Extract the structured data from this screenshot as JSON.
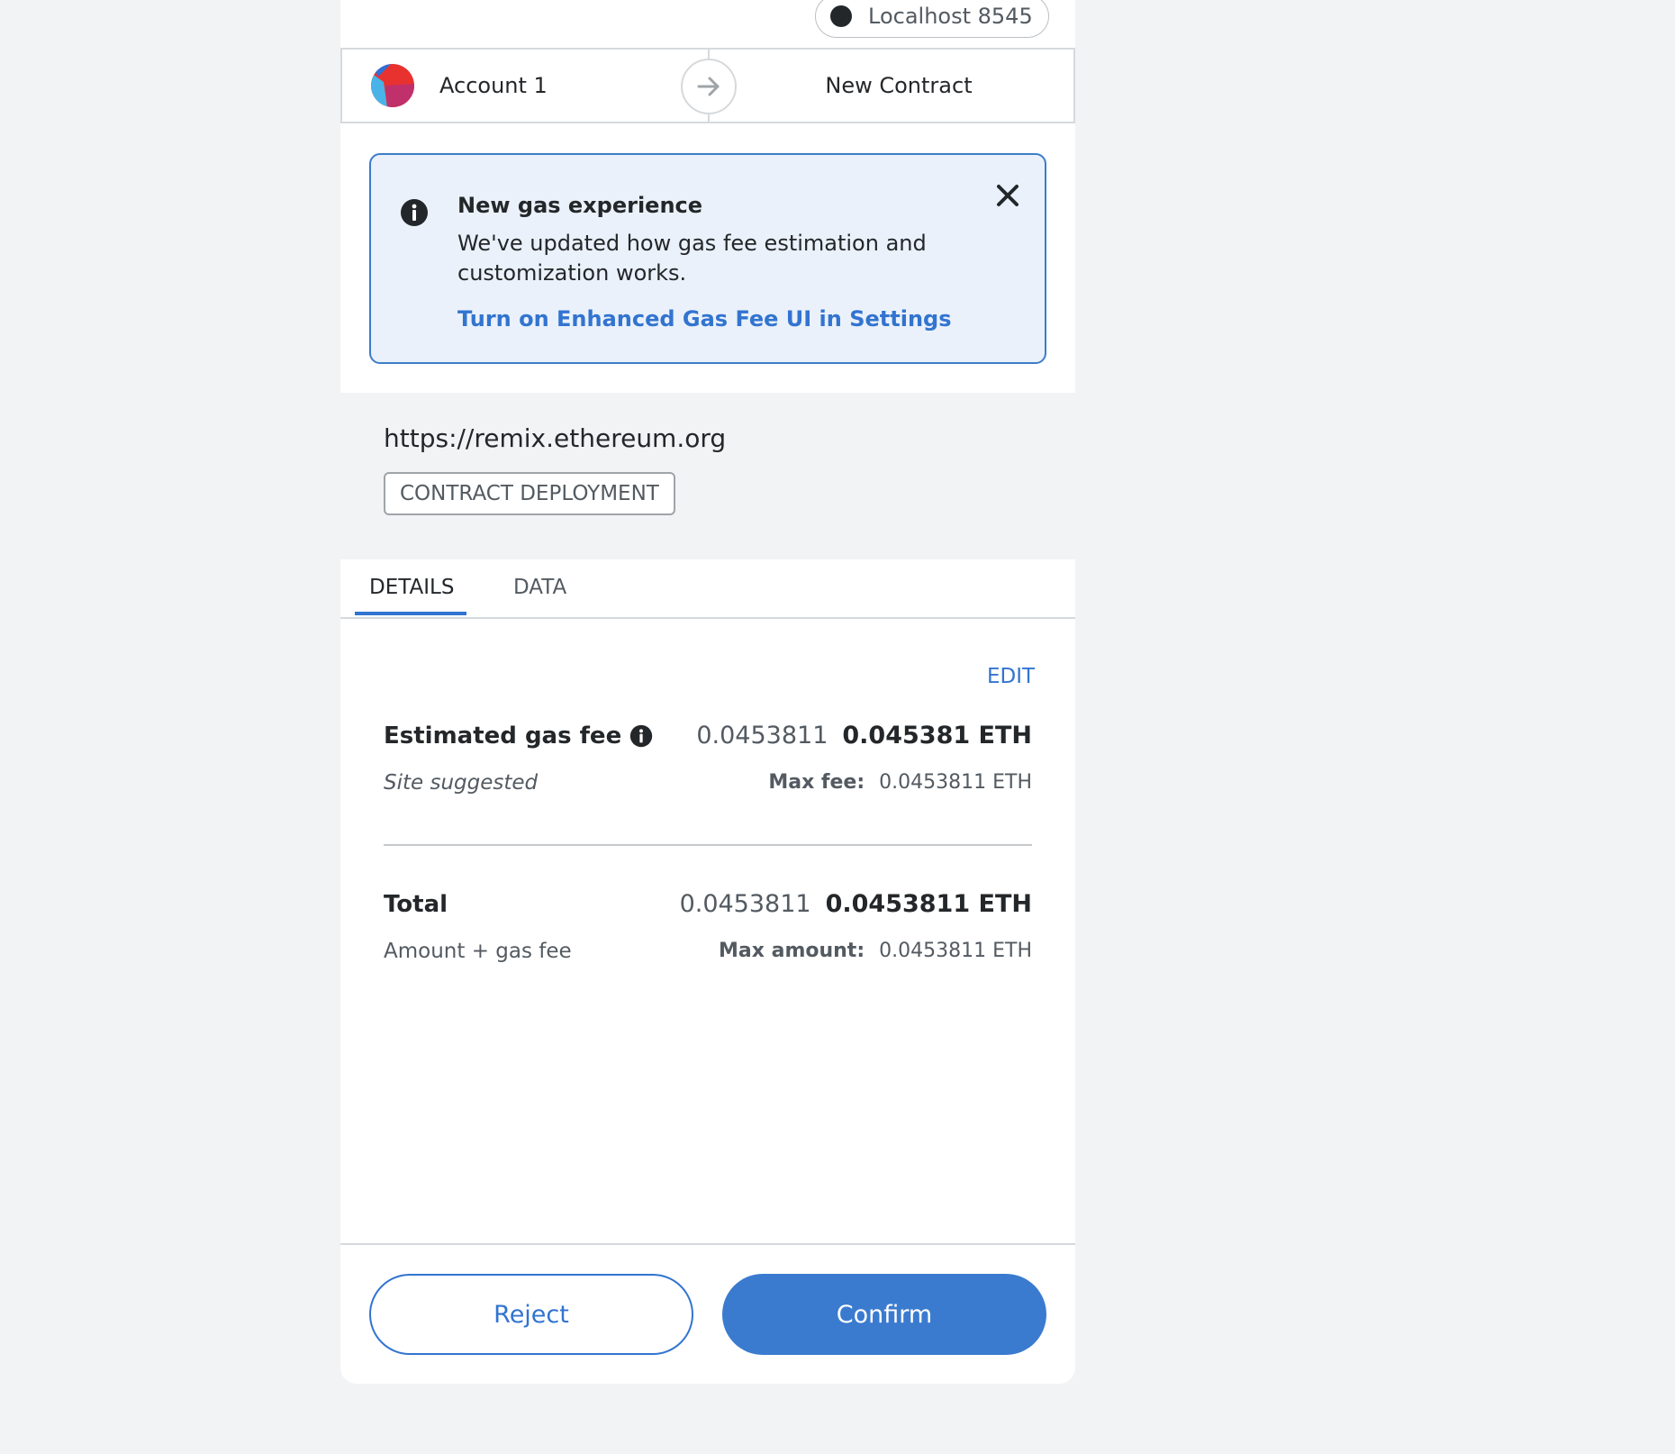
{
  "network": {
    "label": "Localhost 8545"
  },
  "transfer": {
    "sender": "Account 1",
    "recipient": "New Contract"
  },
  "notice": {
    "title": "New gas experience",
    "body": "We've updated how gas fee estimation and customization works.",
    "link": "Turn on Enhanced Gas Fee UI in Settings"
  },
  "origin": {
    "url": "https://remix.ethereum.org",
    "badge": "CONTRACT DEPLOYMENT"
  },
  "tabs": [
    {
      "label": "DETAILS",
      "active": true
    },
    {
      "label": "DATA",
      "active": false
    }
  ],
  "details": {
    "edit_label": "EDIT",
    "gas": {
      "label": "Estimated gas fee",
      "sub": "Site suggested",
      "secondary": "0.0453811",
      "primary": "0.045381 ETH",
      "max_label": "Max fee:",
      "max_value": "0.0453811 ETH"
    },
    "total": {
      "label": "Total",
      "sub": "Amount + gas fee",
      "secondary": "0.0453811",
      "primary": "0.0453811 ETH",
      "max_label": "Max amount:",
      "max_value": "0.0453811 ETH"
    }
  },
  "buttons": {
    "reject": "Reject",
    "confirm": "Confirm"
  },
  "colors": {
    "accent": "#3274d0",
    "notice_bg": "#eaf1fa",
    "page_bg": "#f2f3f4"
  },
  "icons": [
    "identicon",
    "arrow-right-icon",
    "info-icon",
    "close-icon"
  ]
}
